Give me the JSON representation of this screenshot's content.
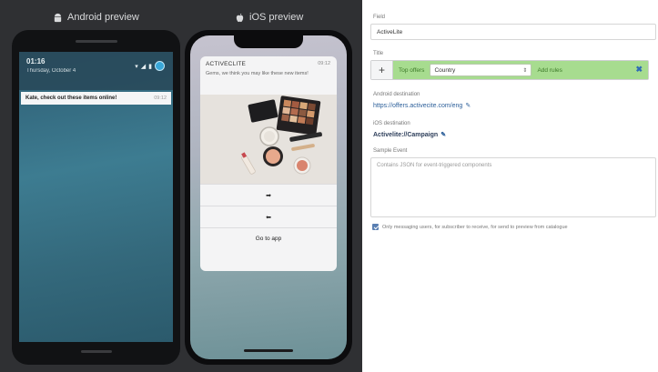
{
  "previews": {
    "android_heading": "Android preview",
    "ios_heading": "iOS preview",
    "android": {
      "status_time": "01:16",
      "status_date": "Thursday, October 4",
      "notification_text": "Kate, check out these items online!",
      "notification_time": "09:12"
    },
    "ios": {
      "app_name": "ACTIVECLITE",
      "notification_time": "09:12",
      "body": "Gems, we think you may like these new items!",
      "action_1_icon": "arrow-right-icon",
      "action_2_icon": "arrow-left-icon",
      "action_3": "Go to app"
    }
  },
  "form": {
    "field1_label": "Field",
    "field1_value": "ActiveLite",
    "field2_label": "Title",
    "link_prefix": "Top offers",
    "link_select": "Country",
    "link_suffix": "Add rules",
    "android_dest_label": "Android destination",
    "android_dest_value": "https://offers.activecite.com/eng",
    "ios_dest_label": "iOS destination",
    "ios_dest_value": "Activelite://Campaign",
    "textarea_label": "Sample Event",
    "textarea_placeholder": "Contains JSON for event-triggered components",
    "checkbox_label": "Only messaging users, for subscriber to receive, for send to preview from catalogue"
  },
  "colors": {
    "accent_green": "#a7dc8f",
    "link_blue": "#2c5f9a"
  }
}
